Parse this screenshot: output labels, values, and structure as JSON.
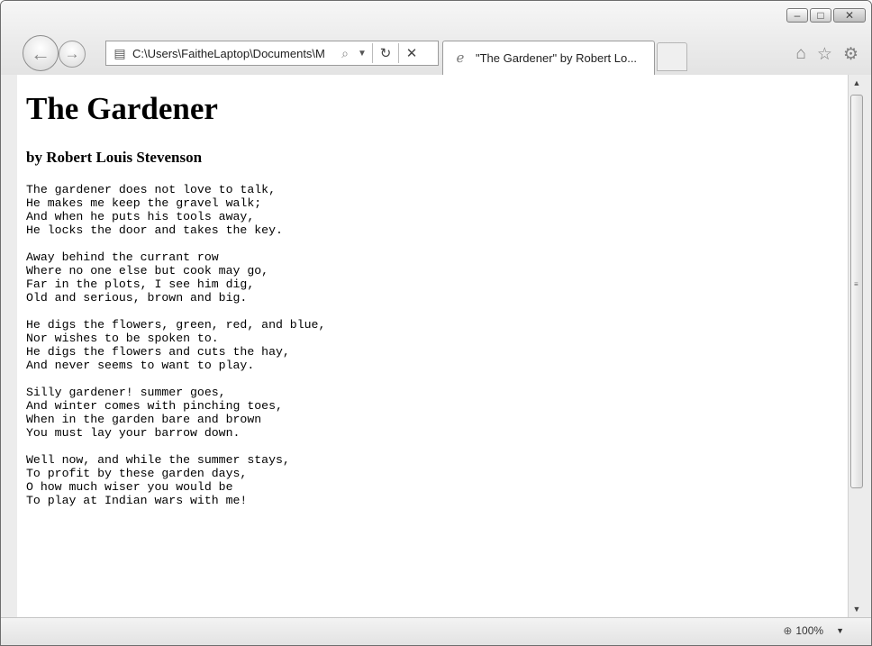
{
  "browser": {
    "address": "C:\\Users\\FaitheLaptop\\Documents\\M",
    "tab_title": "\"The Gardener\" by Robert Lo...",
    "zoom": "100%"
  },
  "icons": {
    "back": "back-arrow-icon",
    "forward": "forward-arrow-icon",
    "page": "page-icon",
    "search": "search-icon",
    "refresh": "refresh-icon",
    "stop": "stop-icon",
    "home": "home-icon",
    "favorites": "star-icon",
    "tools": "gear-icon"
  },
  "document": {
    "title": "The Gardener",
    "byline": "by Robert Louis Stevenson",
    "stanzas": [
      [
        "The gardener does not love to talk,",
        "He makes me keep the gravel walk;",
        "And when he puts his tools away,",
        "He locks the door and takes the key."
      ],
      [
        "Away behind the currant row",
        "Where no one else but cook may go,",
        "Far in the plots, I see him dig,",
        "Old and serious, brown and big."
      ],
      [
        "He digs the flowers, green, red, and blue,",
        "Nor wishes to be spoken to.",
        "He digs the flowers and cuts the hay,",
        "And never seems to want to play."
      ],
      [
        "Silly gardener! summer goes,",
        "And winter comes with pinching toes,",
        "When in the garden bare and brown",
        "You must lay your barrow down."
      ],
      [
        "Well now, and while the summer stays,",
        "To profit by these garden days,",
        "O how much wiser you would be",
        "To play at Indian wars with me!"
      ]
    ]
  }
}
